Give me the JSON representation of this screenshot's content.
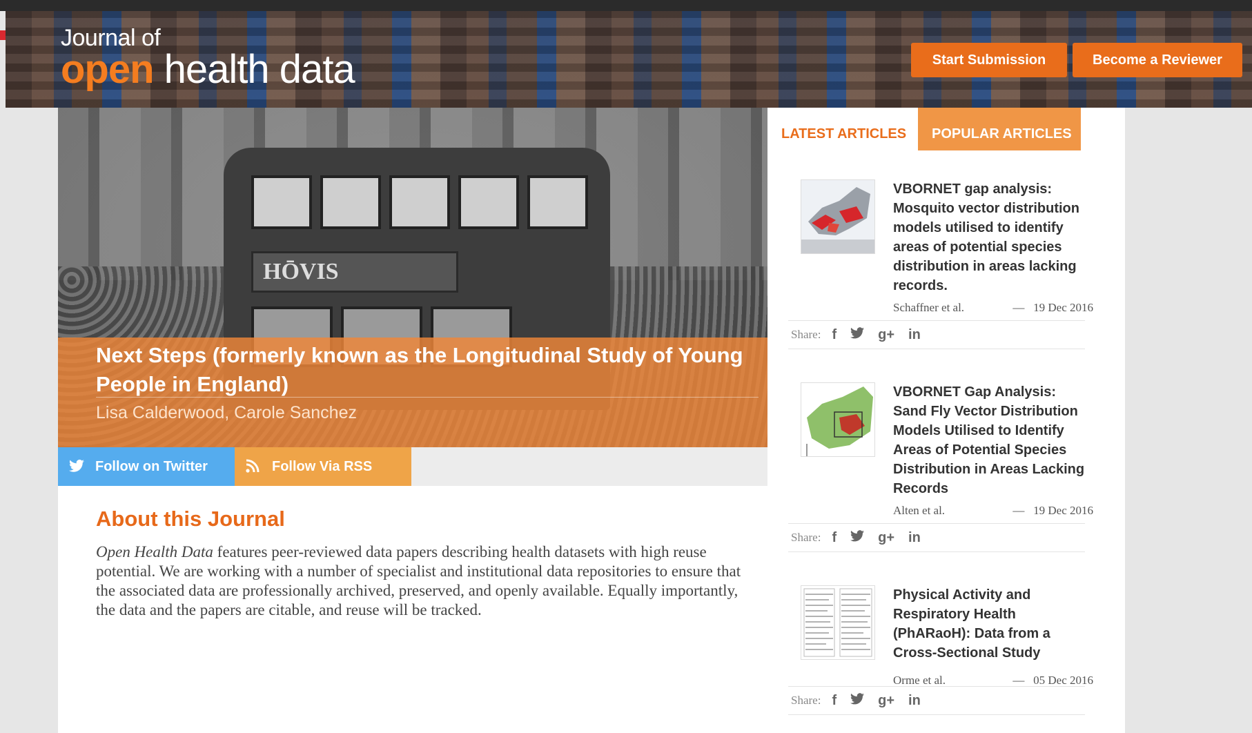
{
  "header": {
    "logo_line1": "Journal of",
    "logo_open": "open",
    "logo_rest": " health data",
    "start_submission": "Start Submission",
    "become_reviewer": "Become a Reviewer"
  },
  "hero": {
    "bus_sign": "HŌVIS",
    "title": "Next Steps (formerly known as the Longitudinal Study of Young People in England)",
    "authors": "Lisa Calderwood, Carole Sanchez"
  },
  "follow": {
    "twitter": "Follow on Twitter",
    "rss": "Follow Via RSS"
  },
  "about": {
    "heading": "About this Journal",
    "journal_name": "Open Health Data",
    "body": " features peer-reviewed data papers describing health datasets with high reuse potential. We are working with a number of specialist and institutional data repositories to ensure that the associated data are professionally archived, preserved, and openly available. Equally importantly, the data and the papers are citable, and reuse will be tracked."
  },
  "tabs": {
    "latest": "LATEST ARTICLES",
    "popular": "POPULAR ARTICLES"
  },
  "articles": [
    {
      "title": "VBORNET gap analysis: Mosquito vector distribution models utilised to identify areas of potential species distribution in areas lacking records.",
      "authors": "Schaffner et al.",
      "date": "19 Dec 2016"
    },
    {
      "title": "VBORNET Gap Analysis: Sand Fly Vector Distribution Models Utilised to Identify Areas of Potential Species Distribution in Areas Lacking Records",
      "authors": "Alten et al.",
      "date": "19 Dec 2016"
    },
    {
      "title": "Physical Activity and Respiratory Health (PhARaoH): Data from a Cross-Sectional Study",
      "authors": "Orme et al.",
      "date": "05 Dec 2016"
    }
  ],
  "share": {
    "label": "Share:",
    "dash": "—",
    "icons": [
      "facebook-icon",
      "twitter-icon",
      "google-plus-icon",
      "linkedin-icon"
    ],
    "facebook_glyph": "f",
    "google_glyph": "g+",
    "linkedin_glyph": "in"
  },
  "colors": {
    "accent": "#e96d1b",
    "hero_overlay": "#ef8638",
    "twitter": "#55acee",
    "rss": "#efa448"
  }
}
